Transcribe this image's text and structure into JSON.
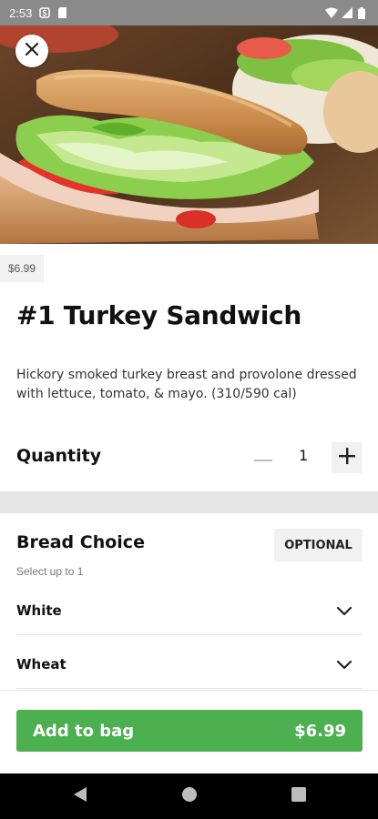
{
  "status_bar": {
    "time": "2:53"
  },
  "product": {
    "price_chip": "$6.99",
    "title": "#1 Turkey Sandwich",
    "description": "Hickory smoked turkey breast and provolone dressed with lettuce, tomato, & mayo. (310/590 cal)"
  },
  "quantity": {
    "label": "Quantity",
    "value": "1"
  },
  "bread_choice": {
    "title": "Bread Choice",
    "subtitle": "Select up to 1",
    "badge": "OPTIONAL",
    "options": [
      {
        "label": "White"
      },
      {
        "label": "Wheat"
      }
    ]
  },
  "cta": {
    "label": "Add to bag",
    "price": "$6.99"
  },
  "colors": {
    "accent_green": "#4caf50",
    "status_bar": "#8a8a8a"
  }
}
